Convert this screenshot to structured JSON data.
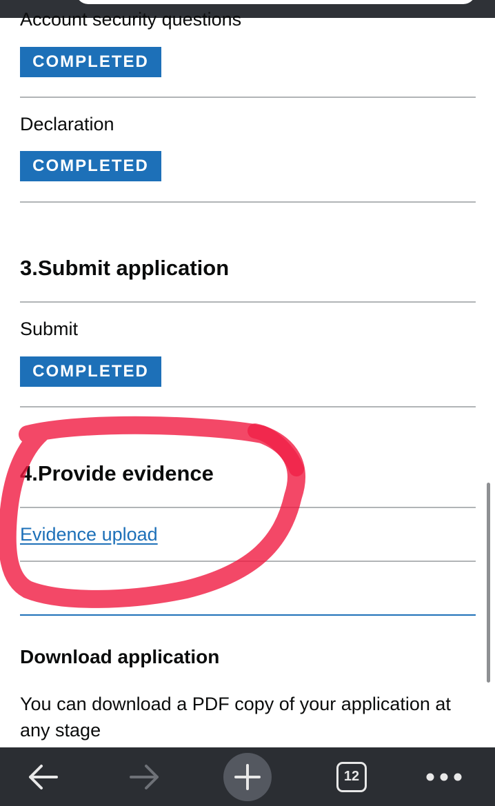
{
  "tasks": [
    {
      "name": "Account security questions",
      "status": "COMPLETED"
    },
    {
      "name": "Declaration",
      "status": "COMPLETED"
    }
  ],
  "sections": [
    {
      "heading": "3.Submit application",
      "task": "Submit",
      "status": "COMPLETED"
    },
    {
      "heading": "4.Provide evidence",
      "link": "Evidence upload"
    }
  ],
  "download": {
    "heading": "Download application",
    "text": "You can download a PDF copy of your application at any stage"
  },
  "toolbar": {
    "tab_count": "12",
    "icons": [
      "back-arrow-icon",
      "forward-arrow-icon",
      "plus-icon",
      "tabs-icon",
      "more-icon"
    ]
  },
  "colors": {
    "tag_blue": "#1d70b8",
    "link_blue": "#1d70b8",
    "annotation_red": "#f0143c",
    "toolbar": "#2b2e33"
  }
}
